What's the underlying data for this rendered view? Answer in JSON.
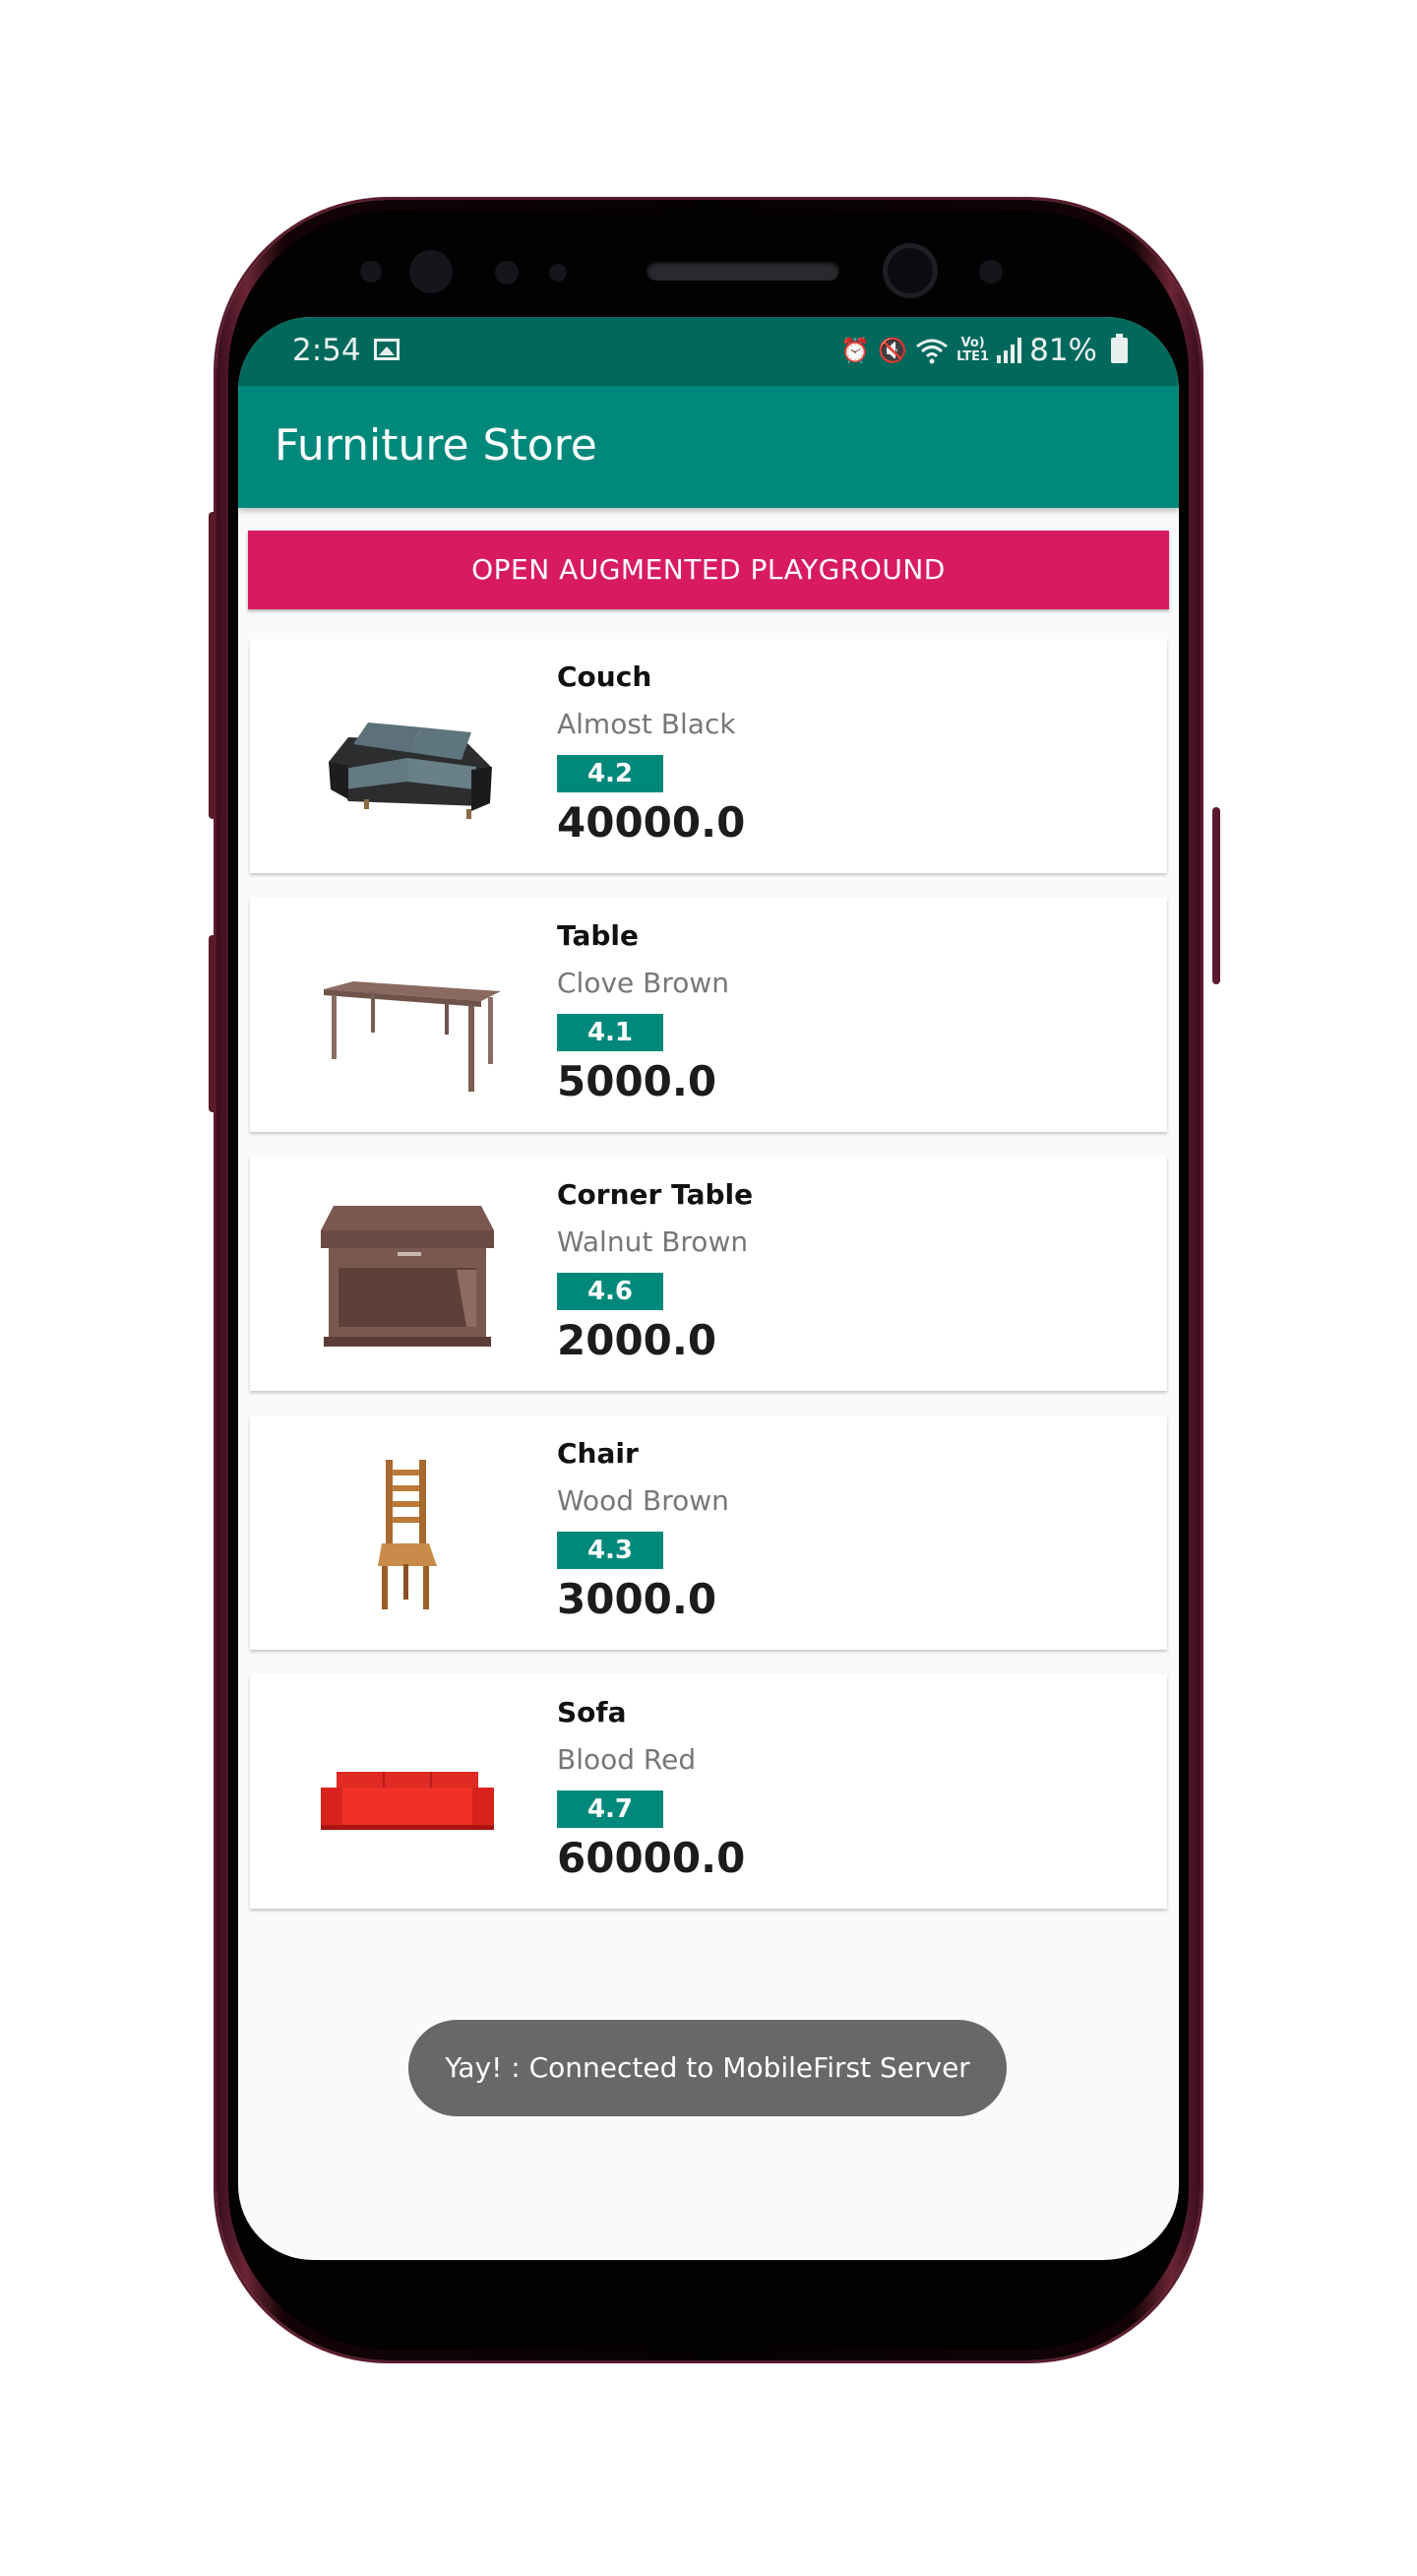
{
  "status_bar": {
    "time": "2:54",
    "battery": "81%",
    "icons": [
      "gallery-icon",
      "alarm-icon",
      "mute-icon",
      "wifi-icon",
      "volte-icon",
      "signal-icon",
      "battery-icon"
    ]
  },
  "app_bar": {
    "title": "Furniture Store"
  },
  "ar_button": {
    "label": "OPEN AUGMENTED PLAYGROUND"
  },
  "products": [
    {
      "name": "Couch",
      "color": "Almost Black",
      "rating": "4.2",
      "price": "40000.0",
      "icon": "couch-icon"
    },
    {
      "name": "Table",
      "color": "Clove Brown",
      "rating": "4.1",
      "price": "5000.0",
      "icon": "table-icon"
    },
    {
      "name": "Corner Table",
      "color": "Walnut Brown",
      "rating": "4.6",
      "price": "2000.0",
      "icon": "corner-table-icon"
    },
    {
      "name": "Chair",
      "color": "Wood Brown",
      "rating": "4.3",
      "price": "3000.0",
      "icon": "chair-icon"
    },
    {
      "name": "Sofa",
      "color": "Blood Red",
      "rating": "4.7",
      "price": "60000.0",
      "icon": "sofa-icon"
    }
  ],
  "toast": {
    "message": "Yay! : Connected to MobileFirst Server"
  },
  "colors": {
    "status_bar": "#00695c",
    "app_bar": "#00897b",
    "accent_button": "#d81b60",
    "rating_badge": "#00897b",
    "toast": "#686868"
  }
}
